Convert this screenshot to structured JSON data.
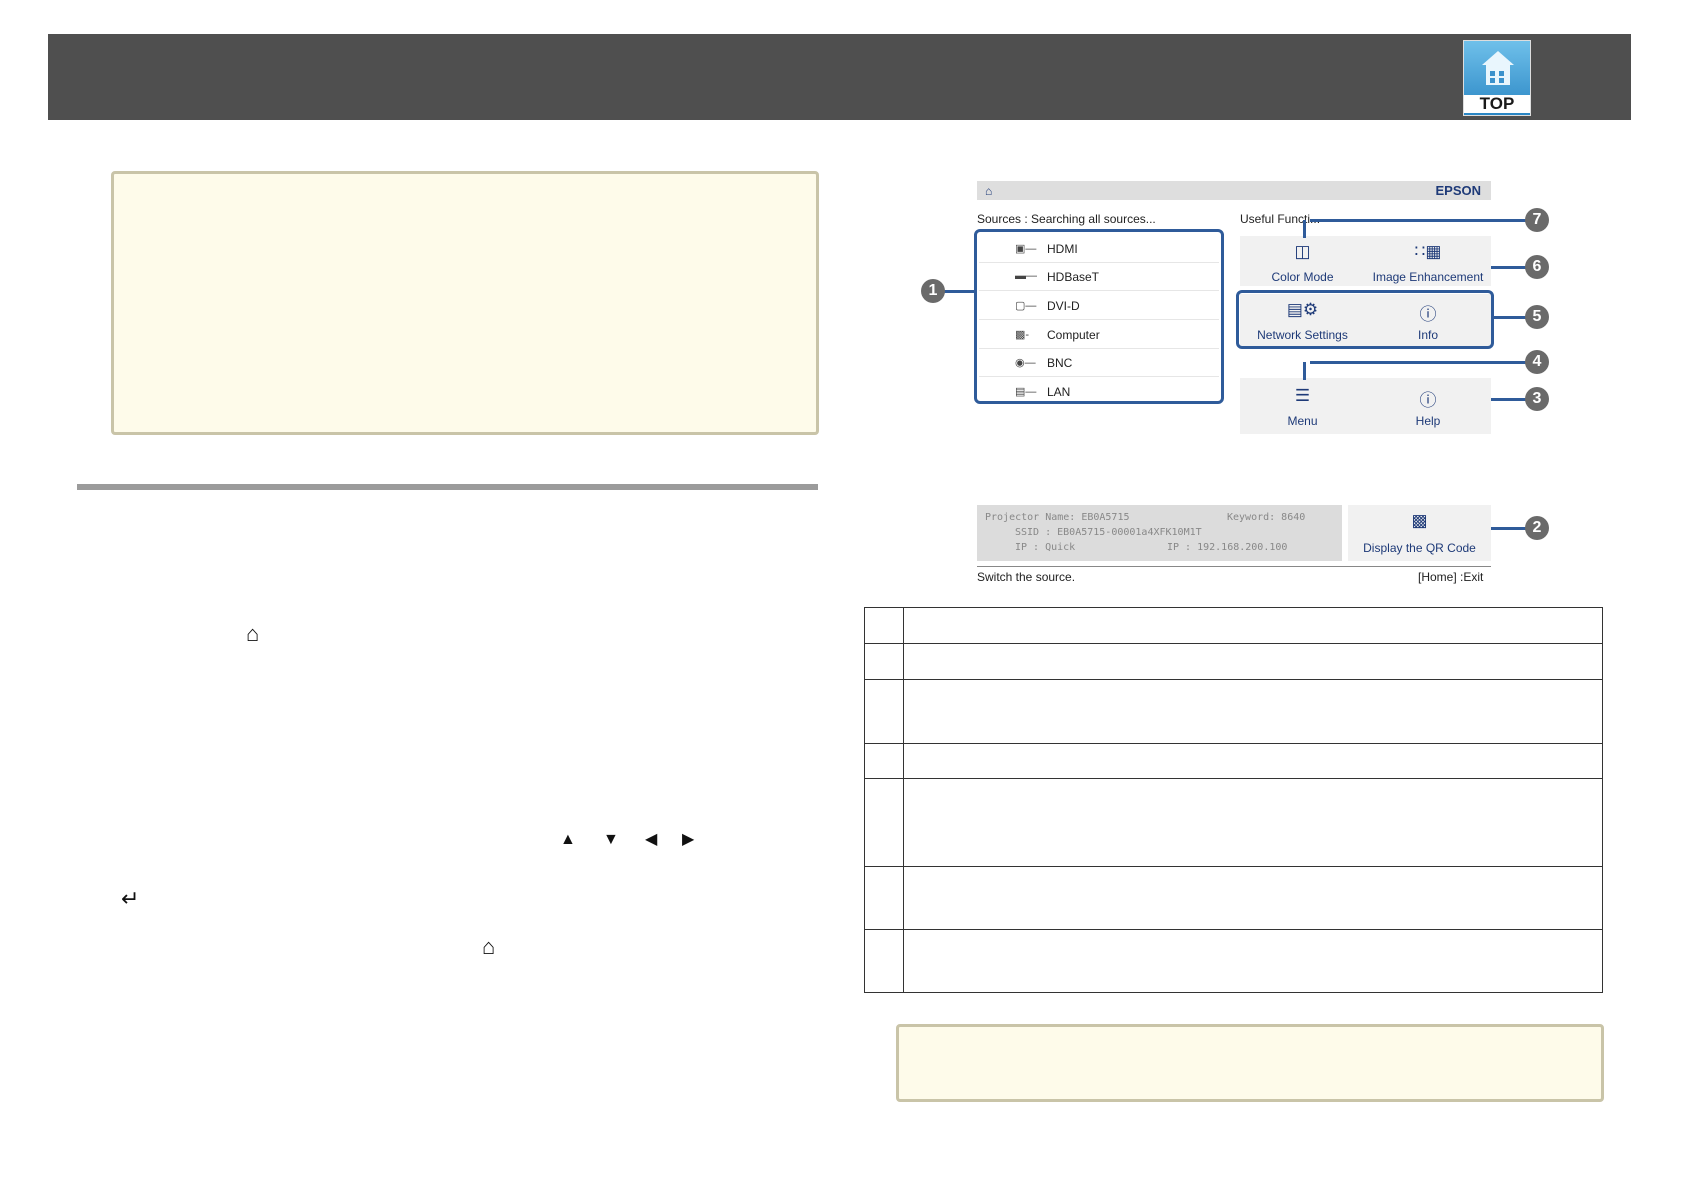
{
  "header": {
    "logo_text": "TOP"
  },
  "screen": {
    "brand": "EPSON",
    "sources_label": "Sources : Searching all sources...",
    "useful_label": "Useful Functi...",
    "sources": [
      {
        "name": "HDMI",
        "icon": "hdmi-port-icon"
      },
      {
        "name": "HDBaseT",
        "icon": "hdbaset-port-icon"
      },
      {
        "name": "DVI-D",
        "icon": "dvi-port-icon"
      },
      {
        "name": "Computer",
        "icon": "computer-port-icon"
      },
      {
        "name": "BNC",
        "icon": "bnc-port-icon"
      },
      {
        "name": "LAN",
        "icon": "lan-port-icon"
      }
    ],
    "functions": {
      "color_mode": "Color Mode",
      "image_enhancement": "Image Enhancement",
      "network_settings": "Network Settings",
      "info": "Info",
      "menu": "Menu",
      "help": "Help",
      "qr": "Display the QR Code"
    },
    "status": {
      "projector_name": "Projector Name: EB0A5715",
      "keyword": "Keyword: 8640",
      "ssid": "SSID : EB0A5715-00001a4XFK10M1T",
      "ip_quick": "IP : Quick",
      "ip_wired": "IP : 192.168.200.100"
    },
    "footer_left": "Switch the source.",
    "footer_right": "[Home] :Exit"
  },
  "callouts": [
    "1",
    "2",
    "3",
    "4",
    "5",
    "6",
    "7"
  ]
}
